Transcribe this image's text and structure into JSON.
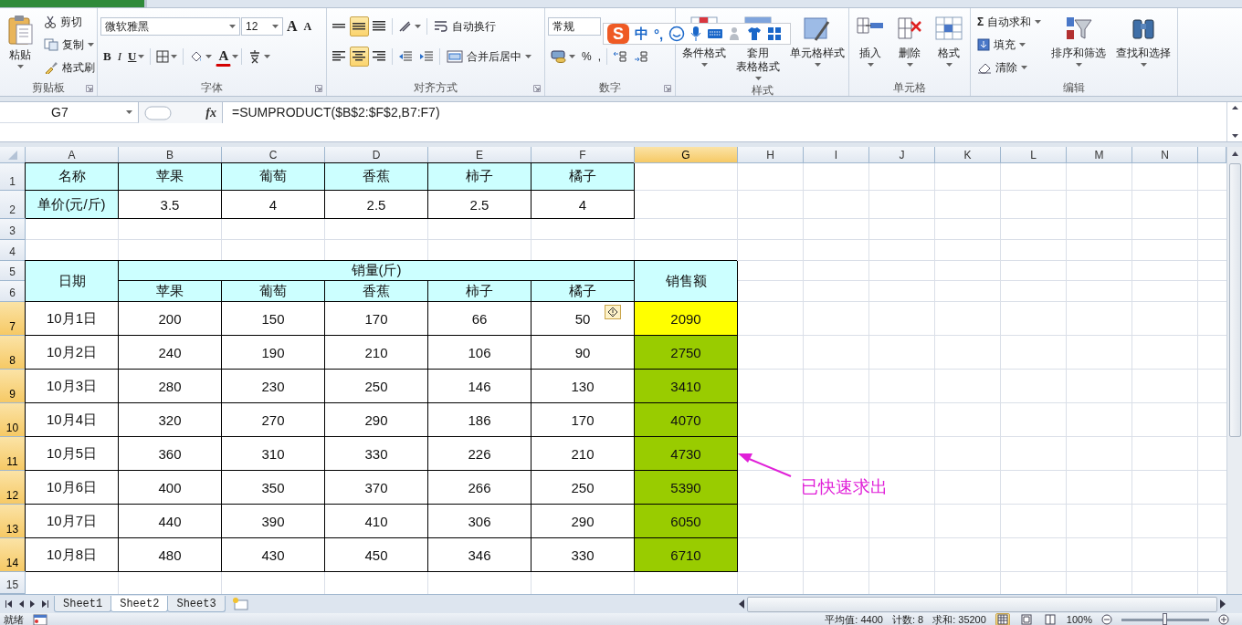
{
  "ribbon": {
    "clipboard": {
      "paste": "粘贴",
      "cut": "剪切",
      "copy": "复制",
      "format_painter": "格式刷",
      "label": "剪贴板"
    },
    "font": {
      "font_name": "微软雅黑",
      "font_size": "12",
      "grow": "A",
      "shrink": "A",
      "bold": "B",
      "italic": "I",
      "underline": "U",
      "font_color": "A",
      "label": "字体"
    },
    "alignment": {
      "vertical_align": [
        {
          "selected": false
        },
        {
          "selected": true
        },
        {
          "selected": false
        }
      ],
      "horizontal_align": [
        {
          "selected": false
        },
        {
          "selected": true
        },
        {
          "selected": false
        }
      ],
      "wrap_text": "自动换行",
      "merge_center": "合并后居中",
      "label": "对齐方式"
    },
    "number": {
      "format": "常规",
      "percent": "%",
      "comma": ",",
      "label": "数字"
    },
    "styles": {
      "conditional": "条件格式",
      "table_format_1": "套用",
      "table_format_2": "表格格式",
      "cell_styles": "单元格样式",
      "label": "样式"
    },
    "cells": {
      "insert": "插入",
      "delete": "删除",
      "format": "格式",
      "label": "单元格"
    },
    "editing": {
      "sum_symbol": "Σ",
      "autosum": "自动求和",
      "fill": "填充",
      "clear": "清除",
      "sort_filter": "排序和筛选",
      "find_select": "查找和选择",
      "label": "编辑"
    }
  },
  "ime_bar": {
    "logo": "S",
    "mode": "中",
    "punctuation": "°,"
  },
  "formula_bar": {
    "name_box": "G7",
    "fx": "fx",
    "formula": "=SUMPRODUCT($B$2:$F$2,B7:F7)"
  },
  "sheet": {
    "columns": [
      {
        "label": "A",
        "selected": false
      },
      {
        "label": "B",
        "selected": false
      },
      {
        "label": "C",
        "selected": false
      },
      {
        "label": "D",
        "selected": false
      },
      {
        "label": "E",
        "selected": false
      },
      {
        "label": "F",
        "selected": false
      },
      {
        "label": "G",
        "selected": true
      },
      {
        "label": "H",
        "selected": false
      },
      {
        "label": "I",
        "selected": false
      },
      {
        "label": "J",
        "selected": false
      },
      {
        "label": "K",
        "selected": false
      },
      {
        "label": "L",
        "selected": false
      },
      {
        "label": "M",
        "selected": false
      },
      {
        "label": "N",
        "selected": false
      }
    ],
    "rows": [
      {
        "label": "1",
        "selected": false
      },
      {
        "label": "2",
        "selected": false
      },
      {
        "label": "3",
        "selected": false
      },
      {
        "label": "4",
        "selected": false
      },
      {
        "label": "5",
        "selected": false
      },
      {
        "label": "6",
        "selected": false
      },
      {
        "label": "7",
        "selected": true
      },
      {
        "label": "8",
        "selected": true
      },
      {
        "label": "9",
        "selected": true
      },
      {
        "label": "10",
        "selected": true
      },
      {
        "label": "11",
        "selected": true
      },
      {
        "label": "12",
        "selected": true
      },
      {
        "label": "13",
        "selected": true
      },
      {
        "label": "14",
        "selected": true
      },
      {
        "label": "15",
        "selected": false
      }
    ],
    "price_table": {
      "rows": [
        [
          {
            "text": "名称",
            "color": "#ccffff"
          },
          {
            "text": "苹果",
            "color": "#ccffff"
          },
          {
            "text": "葡萄",
            "color": "#ccffff"
          },
          {
            "text": "香蕉",
            "color": "#ccffff"
          },
          {
            "text": "柿子",
            "color": "#ccffff"
          },
          {
            "text": "橘子",
            "color": "#ccffff"
          }
        ],
        [
          {
            "text": "单价(元/斤)",
            "color": "#ccffff"
          },
          {
            "text": "3.5",
            "color": "#ffffff"
          },
          {
            "text": "4",
            "color": "#ffffff"
          },
          {
            "text": "2.5",
            "color": "#ffffff"
          },
          {
            "text": "2.5",
            "color": "#ffffff"
          },
          {
            "text": "4",
            "color": "#ffffff"
          }
        ]
      ]
    },
    "sales_table": {
      "date_header": {
        "text": "日期",
        "color": "#ccffff"
      },
      "quantity_header": {
        "text": "销量(斤)",
        "color": "#ccffff"
      },
      "total_header": {
        "text": "销售额",
        "color": "#ccffff"
      },
      "fruits": [
        {
          "text": "苹果",
          "color": "#ccffff"
        },
        {
          "text": "葡萄",
          "color": "#ccffff"
        },
        {
          "text": "香蕉",
          "color": "#ccffff"
        },
        {
          "text": "柿子",
          "color": "#ccffff"
        },
        {
          "text": "橘子",
          "color": "#ccffff"
        }
      ],
      "rows": [
        [
          {
            "text": "10月1日",
            "color": "#ffffff"
          },
          {
            "text": "200",
            "color": "#ffffff"
          },
          {
            "text": "150",
            "color": "#ffffff"
          },
          {
            "text": "170",
            "color": "#ffffff"
          },
          {
            "text": "66",
            "color": "#ffffff"
          },
          {
            "text": "50",
            "color": "#ffffff"
          },
          {
            "text": "2090",
            "color": "#ffff00"
          }
        ],
        [
          {
            "text": "10月2日",
            "color": "#ffffff"
          },
          {
            "text": "240",
            "color": "#ffffff"
          },
          {
            "text": "190",
            "color": "#ffffff"
          },
          {
            "text": "210",
            "color": "#ffffff"
          },
          {
            "text": "106",
            "color": "#ffffff"
          },
          {
            "text": "90",
            "color": "#ffffff"
          },
          {
            "text": "2750",
            "color": "#99cc00"
          }
        ],
        [
          {
            "text": "10月3日",
            "color": "#ffffff"
          },
          {
            "text": "280",
            "color": "#ffffff"
          },
          {
            "text": "230",
            "color": "#ffffff"
          },
          {
            "text": "250",
            "color": "#ffffff"
          },
          {
            "text": "146",
            "color": "#ffffff"
          },
          {
            "text": "130",
            "color": "#ffffff"
          },
          {
            "text": "3410",
            "color": "#99cc00"
          }
        ],
        [
          {
            "text": "10月4日",
            "color": "#ffffff"
          },
          {
            "text": "320",
            "color": "#ffffff"
          },
          {
            "text": "270",
            "color": "#ffffff"
          },
          {
            "text": "290",
            "color": "#ffffff"
          },
          {
            "text": "186",
            "color": "#ffffff"
          },
          {
            "text": "170",
            "color": "#ffffff"
          },
          {
            "text": "4070",
            "color": "#99cc00"
          }
        ],
        [
          {
            "text": "10月5日",
            "color": "#ffffff"
          },
          {
            "text": "360",
            "color": "#ffffff"
          },
          {
            "text": "310",
            "color": "#ffffff"
          },
          {
            "text": "330",
            "color": "#ffffff"
          },
          {
            "text": "226",
            "color": "#ffffff"
          },
          {
            "text": "210",
            "color": "#ffffff"
          },
          {
            "text": "4730",
            "color": "#99cc00"
          }
        ],
        [
          {
            "text": "10月6日",
            "color": "#ffffff"
          },
          {
            "text": "400",
            "color": "#ffffff"
          },
          {
            "text": "350",
            "color": "#ffffff"
          },
          {
            "text": "370",
            "color": "#ffffff"
          },
          {
            "text": "266",
            "color": "#ffffff"
          },
          {
            "text": "250",
            "color": "#ffffff"
          },
          {
            "text": "5390",
            "color": "#99cc00"
          }
        ],
        [
          {
            "text": "10月7日",
            "color": "#ffffff"
          },
          {
            "text": "440",
            "color": "#ffffff"
          },
          {
            "text": "390",
            "color": "#ffffff"
          },
          {
            "text": "410",
            "color": "#ffffff"
          },
          {
            "text": "306",
            "color": "#ffffff"
          },
          {
            "text": "290",
            "color": "#ffffff"
          },
          {
            "text": "6050",
            "color": "#99cc00"
          }
        ],
        [
          {
            "text": "10月8日",
            "color": "#ffffff"
          },
          {
            "text": "480",
            "color": "#ffffff"
          },
          {
            "text": "430",
            "color": "#ffffff"
          },
          {
            "text": "450",
            "color": "#ffffff"
          },
          {
            "text": "346",
            "color": "#ffffff"
          },
          {
            "text": "330",
            "color": "#ffffff"
          },
          {
            "text": "6710",
            "color": "#99cc00"
          }
        ]
      ]
    },
    "annotation": "已快速求出"
  },
  "sheet_tabs": [
    {
      "label": "Sheet1",
      "selected": false
    },
    {
      "label": "Sheet2",
      "selected": true
    },
    {
      "label": "Sheet3",
      "selected": false
    }
  ],
  "status_bar": {
    "ready": "就绪",
    "average": "平均值: 4400",
    "count": "计数: 8",
    "sum": "求和: 35200",
    "views": [
      {
        "selected": true
      },
      {
        "selected": false
      },
      {
        "selected": false
      }
    ],
    "zoom": "100%",
    "zoom_slider": {
      "level": 0.5
    }
  }
}
